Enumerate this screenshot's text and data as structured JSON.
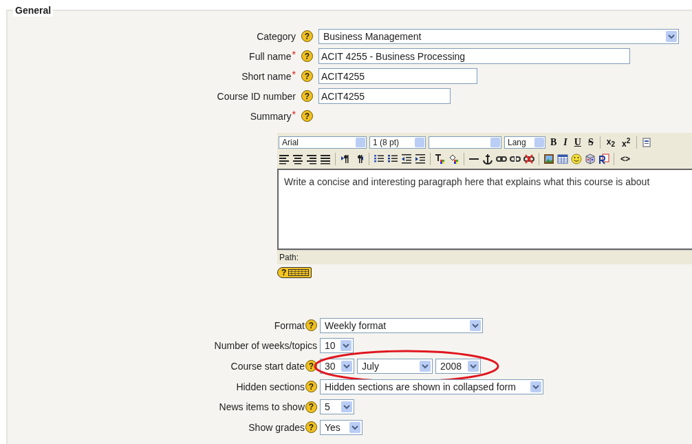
{
  "fieldset": {
    "legend": "General"
  },
  "fields_top": [
    {
      "label": "Category",
      "help": "?",
      "kind": "select",
      "value": "Business Management"
    },
    {
      "label": "Full name",
      "required_mark": "*",
      "help": "?",
      "kind": "input",
      "value": "ACIT 4255 - Business Processing"
    },
    {
      "label": "Short name",
      "required_mark": "*",
      "help": "?",
      "kind": "input",
      "value": "ACIT4255"
    },
    {
      "label": "Course ID number",
      "help": "?",
      "kind": "input",
      "value": "ACIT4255"
    },
    {
      "label": "Summary",
      "required_mark": "*",
      "help": "?",
      "kind": "none"
    }
  ],
  "editor": {
    "font": "Arial",
    "size": "1 (8 pt)",
    "lang": "Lang",
    "format_buttons": [
      "B",
      "I",
      "U",
      "S"
    ],
    "script_buttons": [
      "x$_{2}$",
      "x$^{2}$"
    ],
    "source_button": "<>",
    "content": "Write a concise and interesting paragraph here that explains what this course is about",
    "path_label": "Path:",
    "keyboard_help": "?"
  },
  "fields_bottom": [
    {
      "label": "Format",
      "help": "?",
      "selects": [
        "Weekly format"
      ]
    },
    {
      "label": "Number of weeks/topics",
      "selects": [
        "10"
      ]
    },
    {
      "label": "Course start date",
      "help": "?",
      "selects": [
        "30",
        "July",
        "2008"
      ],
      "highlighted": true
    },
    {
      "label": "Hidden sections",
      "help": "?",
      "selects": [
        "Hidden sections are shown in collapsed form"
      ]
    },
    {
      "label": "News items to show",
      "help": "?",
      "selects": [
        "5"
      ]
    },
    {
      "label": "Show grades",
      "help": "?",
      "selects": [
        "Yes"
      ]
    }
  ]
}
